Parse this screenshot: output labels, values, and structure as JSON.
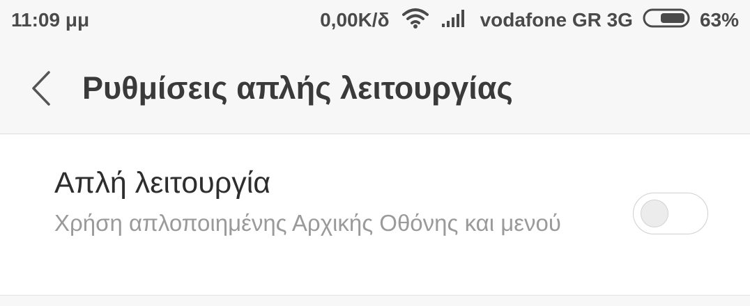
{
  "status_bar": {
    "time": "11:09 μμ",
    "network_speed": "0,00K/δ",
    "carrier": "vodafone GR 3G",
    "battery_percent": "63%",
    "battery_level": 0.63
  },
  "header": {
    "back_icon": "chevron-left-icon",
    "title": "Ρυθμίσεις απλής λειτουργίας"
  },
  "settings": {
    "simple_mode": {
      "title": "Απλή λειτουργία",
      "summary": "Χρήση απλοποιημένης Αρχικής Οθόνης και μενού",
      "enabled": false
    }
  },
  "colors": {
    "background": "#f7f7f7",
    "card": "#ffffff",
    "text_primary": "#2e2e2e",
    "text_secondary": "#9a9a9a",
    "status_text": "#4a4a4a"
  }
}
